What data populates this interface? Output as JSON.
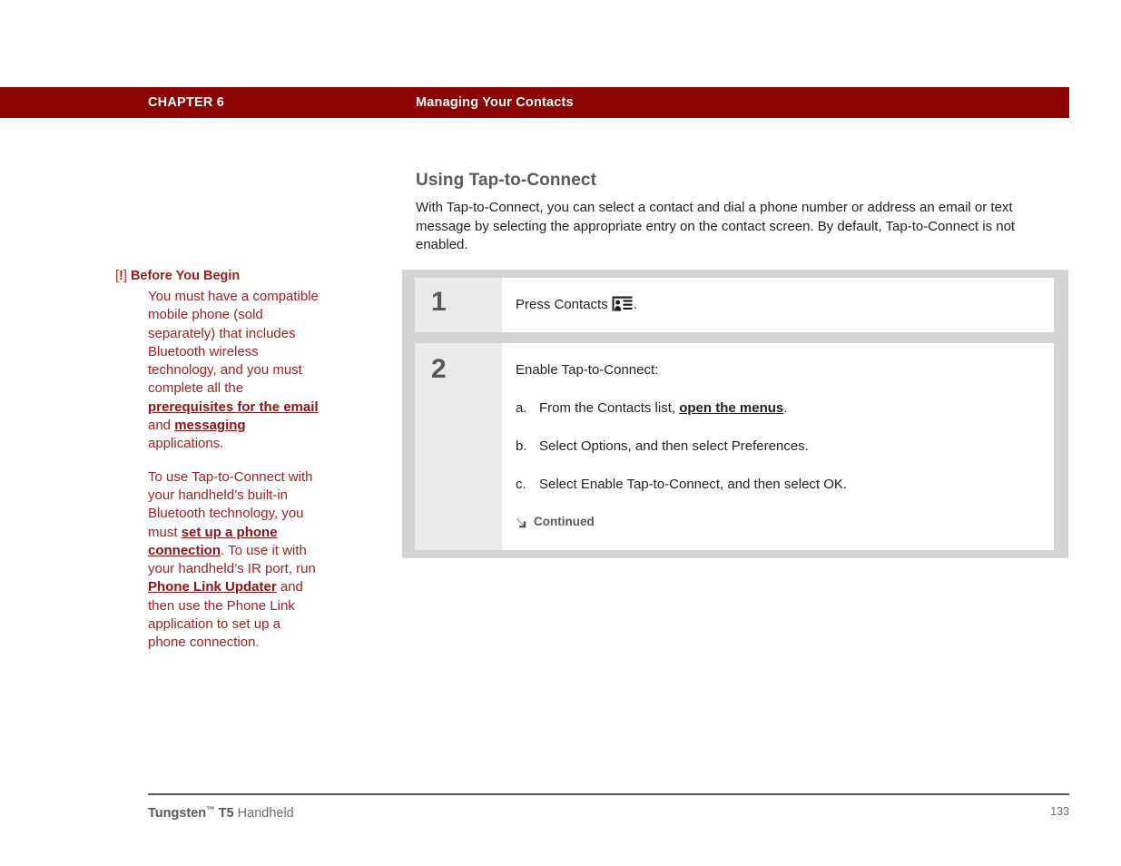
{
  "header": {
    "chapter_label": "CHAPTER 6",
    "chapter_title": "Managing Your Contacts",
    "bar_color": "#8c0304"
  },
  "sidebar": {
    "marker_open": "[",
    "marker_bang": "!",
    "marker_close": "]",
    "heading": "Before You Begin",
    "accent_color": "#9e2124",
    "paragraphs": [
      {
        "segments": [
          {
            "text": "You must have a compatible mobile phone (sold separately) that includes Bluetooth wireless technology, and you must complete all the ",
            "style": "normal"
          },
          {
            "text": "prerequisites for the email",
            "style": "link"
          },
          {
            "text": " and ",
            "style": "normal"
          },
          {
            "text": "messaging",
            "style": "link"
          },
          {
            "text": " applications.",
            "style": "normal"
          }
        ]
      },
      {
        "segments": [
          {
            "text": "To use Tap-to-Connect with your handheld’s built-in Bluetooth technology, you must ",
            "style": "normal"
          },
          {
            "text": "set up a phone connection",
            "style": "link"
          },
          {
            "text": ". To use it with your handheld’s IR port, run ",
            "style": "normal"
          },
          {
            "text": "Phone Link Updater",
            "style": "link"
          },
          {
            "text": " and then use the Phone Link application to set up a phone connection.",
            "style": "normal"
          }
        ]
      }
    ]
  },
  "main": {
    "heading": "Using Tap-to-Connect",
    "heading_color": "#58595b",
    "intro": "With Tap-to-Connect, you can select a contact and dial a phone number or address an email or text message by selecting the appropriate entry on the contact screen. By default, Tap-to-Connect is not enabled."
  },
  "steps": [
    {
      "number": "1",
      "lines": [
        {
          "segments": [
            {
              "text": "Press Contacts",
              "style": "normal"
            },
            {
              "text": "contacts-icon",
              "style": "icon"
            },
            {
              "text": ".",
              "style": "normal"
            }
          ]
        }
      ],
      "substeps": [],
      "continued": null
    },
    {
      "number": "2",
      "lines": [
        {
          "segments": [
            {
              "text": "Enable Tap-to-Connect:",
              "style": "normal"
            }
          ]
        }
      ],
      "substeps": [
        {
          "marker": "a.",
          "segments": [
            {
              "text": "From the Contacts list, ",
              "style": "normal"
            },
            {
              "text": "open the menus",
              "style": "link"
            },
            {
              "text": ".",
              "style": "normal"
            }
          ]
        },
        {
          "marker": "b.",
          "segments": [
            {
              "text": "Select Options, and then select Preferences.",
              "style": "normal"
            }
          ]
        },
        {
          "marker": "c.",
          "segments": [
            {
              "text": "Select Enable Tap-to-Connect, and then select OK.",
              "style": "normal"
            }
          ]
        }
      ],
      "continued": {
        "icon": "arrow-down-right-icon",
        "label": "Continued"
      }
    }
  ],
  "footer": {
    "brand": "Tungsten",
    "trademark": "™",
    "model": " T5",
    "product": " Handheld",
    "page_number": "133"
  }
}
